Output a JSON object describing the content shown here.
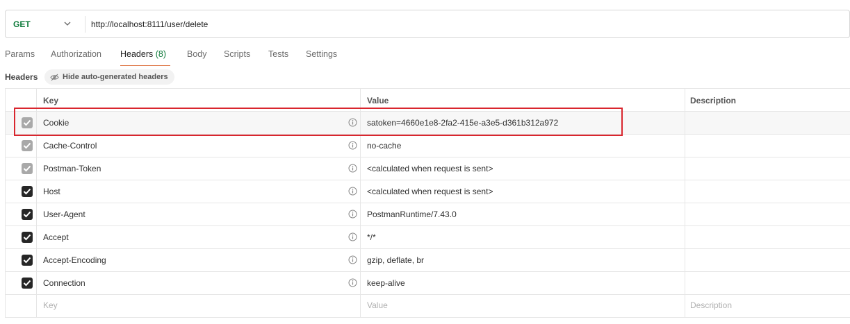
{
  "request": {
    "method": "GET",
    "url": "http://localhost:8111/user/delete"
  },
  "tabs": [
    {
      "label": "Params"
    },
    {
      "label": "Authorization"
    },
    {
      "label": "Headers",
      "count": "(8)",
      "active": true
    },
    {
      "label": "Body"
    },
    {
      "label": "Scripts"
    },
    {
      "label": "Tests"
    },
    {
      "label": "Settings"
    }
  ],
  "headers_section": {
    "label": "Headers",
    "hide_button": "Hide auto-generated headers"
  },
  "table": {
    "columns": {
      "key": "Key",
      "value": "Value",
      "description": "Description"
    },
    "rows": [
      {
        "key": "Cookie",
        "value": "satoken=4660e1e8-2fa2-415e-a3e5-d361b312a972",
        "checked": true,
        "auto": true,
        "highlighted": true
      },
      {
        "key": "Cache-Control",
        "value": "no-cache",
        "checked": true,
        "auto": true
      },
      {
        "key": "Postman-Token",
        "value": "<calculated when request is sent>",
        "checked": true,
        "auto": true
      },
      {
        "key": "Host",
        "value": "<calculated when request is sent>",
        "checked": true,
        "auto": false
      },
      {
        "key": "User-Agent",
        "value": "PostmanRuntime/7.43.0",
        "checked": true,
        "auto": false
      },
      {
        "key": "Accept",
        "value": "*/*",
        "checked": true,
        "auto": false
      },
      {
        "key": "Accept-Encoding",
        "value": "gzip, deflate, br",
        "checked": true,
        "auto": false
      },
      {
        "key": "Connection",
        "value": "keep-alive",
        "checked": true,
        "auto": false
      }
    ],
    "new_row": {
      "key_placeholder": "Key",
      "value_placeholder": "Value",
      "description_placeholder": "Description"
    }
  },
  "colors": {
    "method": "#0f7b3b",
    "tab_active_underline": "#e07b4c",
    "highlight_box": "#d9262e",
    "checkbox_checked": "#262626",
    "checkbox_auto": "#a9a9a9"
  },
  "icons": {
    "method_dropdown": "chevron-down-icon",
    "hide_headers": "eye-off-icon",
    "row_info": "info-circle-icon",
    "checkbox": "checkmark-icon"
  }
}
